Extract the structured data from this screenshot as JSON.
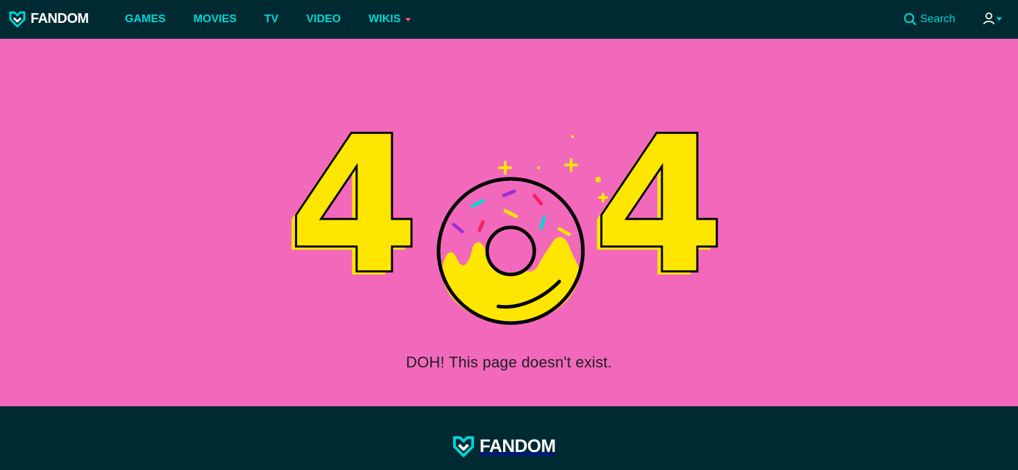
{
  "header": {
    "logo_text": "FANDOM",
    "nav": [
      {
        "label": "GAMES"
      },
      {
        "label": "MOVIES"
      },
      {
        "label": "TV"
      },
      {
        "label": "VIDEO"
      },
      {
        "label": "WIKIS"
      }
    ],
    "search_label": "Search",
    "user_icon": "user-icon"
  },
  "main": {
    "error_digits": [
      "4",
      "4"
    ],
    "message": "DOH! This page doesn't exist."
  },
  "footer": {
    "logo_text": "FANDOM"
  },
  "colors": {
    "header_bg": "#002a32",
    "accent": "#00d6d6",
    "page_bg": "#f269bc",
    "donut_yellow": "#ffe600",
    "caret_pink": "#fa5c7c"
  }
}
